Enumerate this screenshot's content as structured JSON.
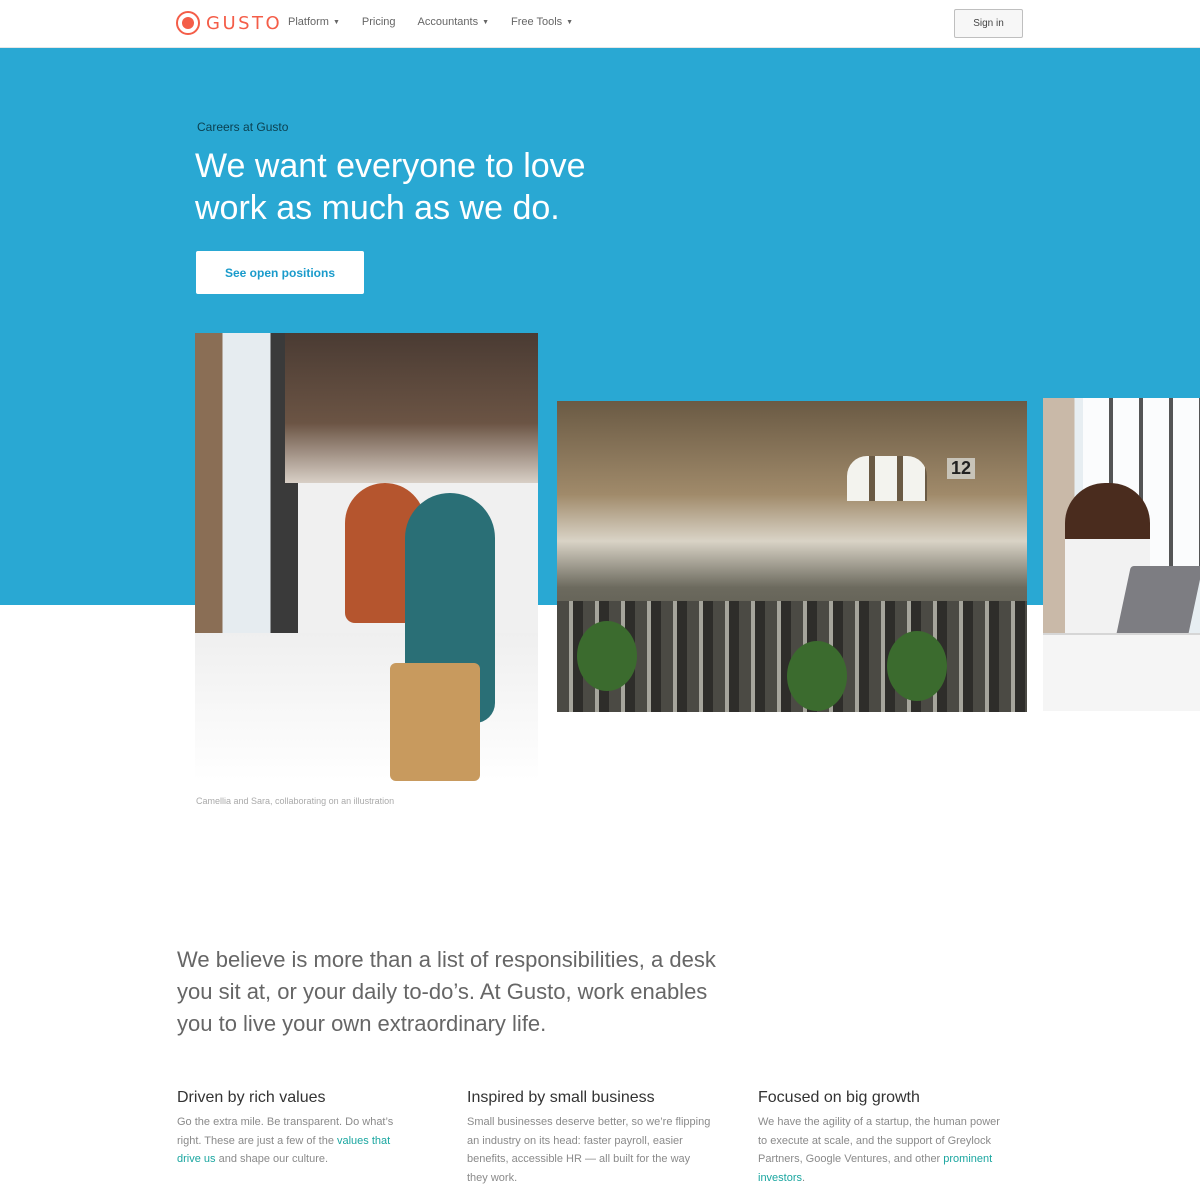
{
  "nav": {
    "logo": "GUSTO",
    "links": [
      {
        "label": "Platform",
        "has_dropdown": true
      },
      {
        "label": "Pricing",
        "has_dropdown": false
      },
      {
        "label": "Accountants",
        "has_dropdown": true
      },
      {
        "label": "Free Tools",
        "has_dropdown": true
      }
    ],
    "signin_label": "Sign in"
  },
  "hero": {
    "eyebrow": "Careers at Gusto",
    "headline": "We want everyone to love work as much as we do.",
    "cta_label": "See open positions",
    "background_color": "#29a8d3"
  },
  "photos": {
    "caption": "Camellia and Sara, collaborating on an illustration",
    "sign_text": "12"
  },
  "lead": {
    "text": "We believe   is more than a list of responsibilities, a desk you sit at, or your daily to-do’s. At Gusto, work enables you to live your own extraordinary life."
  },
  "columns": [
    {
      "title": "Driven by rich values",
      "before": "Go the extra mile. Be transparent. Do what’s right. These are just a few of the ",
      "link": "values that drive us",
      "after": " and shape our culture."
    },
    {
      "title": "Inspired by small business",
      "before": "Small businesses deserve better, so we’re flipping an industry on its head: faster payroll, easier benefits, accessible HR — all built for the way they work.",
      "link": "",
      "after": ""
    },
    {
      "title": "Focused on big growth",
      "before": "We have the agility of a startup, the human power to execute at scale, and the support of Greylock Partners, Google Ventures, and other ",
      "link": "prominent investors",
      "after": "."
    }
  ],
  "colors": {
    "brand": "#f45d48",
    "link": "#1aa6a0"
  }
}
